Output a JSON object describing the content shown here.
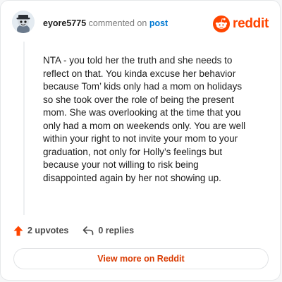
{
  "comment": {
    "username": "eyore5775",
    "commented_text": "commented on",
    "post_link": "post",
    "body": "NTA - you told her the truth and she needs to reflect on that. You kinda excuse her behavior because Tom’ kids only had a mom on holidays so she took over the role of being the present mom. She was overlooking at the time that you only had a mom on weekends only. You are well within your right to not invite your mom to your graduation, not only for Holly’s feelings but because your not willing to risk being disappointed again by her not showing up."
  },
  "brand": {
    "name": "reddit",
    "icon": "reddit-logo-icon",
    "color": "#ff4500"
  },
  "actions": {
    "upvotes": "2 upvotes",
    "replies": "0 replies",
    "upvote_icon": "upvote-arrow-icon",
    "reply_icon": "reply-arrow-icon",
    "upvote_color": "#ff4500"
  },
  "view_button": {
    "label": "View more on Reddit"
  },
  "colors": {
    "link": "#0079d3",
    "button_text": "#d93a00"
  }
}
